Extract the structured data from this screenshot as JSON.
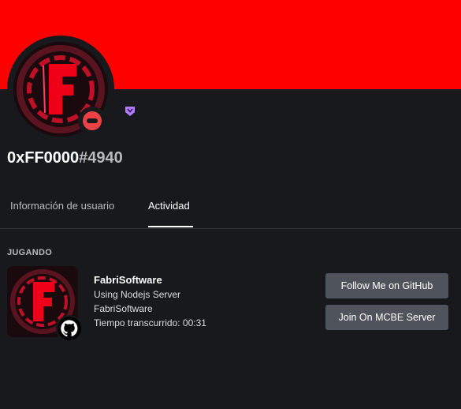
{
  "colors": {
    "banner": "#ff0000",
    "background": "#18191c",
    "status_dnd": "#ed4245",
    "badge": "#b07cff",
    "button_bg": "#4f545c"
  },
  "profile": {
    "username": "0xFF0000",
    "discriminator": "#4940",
    "status": "do-not-disturb"
  },
  "tabs": [
    {
      "label": "Información de usuario",
      "active": false
    },
    {
      "label": "Actividad",
      "active": true
    }
  ],
  "activity": {
    "section_label": "JUGANDO",
    "name": "FabriSoftware",
    "details": "Using Nodejs Server",
    "state": "FabriSoftware",
    "elapsed": "Tiempo transcurrido: 00:31",
    "small_icon": "github-icon"
  },
  "buttons": [
    {
      "label": "Follow Me on GitHub"
    },
    {
      "label": "Join On MCBE Server"
    }
  ]
}
